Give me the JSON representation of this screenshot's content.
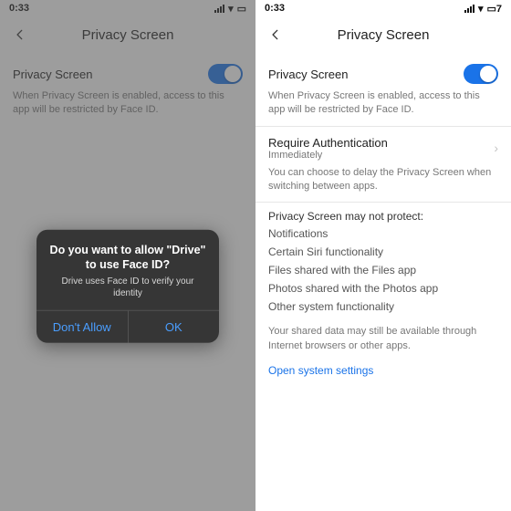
{
  "status": {
    "time": "0:33",
    "battery_right": "7"
  },
  "header": {
    "title": "Privacy Screen"
  },
  "toggle_row": {
    "label": "Privacy Screen",
    "on": true
  },
  "desc1": "When Privacy Screen is enabled, access to this app will be restricted by Face ID.",
  "req": {
    "label": "Require Authentication",
    "value": "Immediately"
  },
  "desc2": "You can choose to delay the Privacy Screen when switching between apps.",
  "list": {
    "head": "Privacy Screen may not protect:",
    "items": [
      "Notifications",
      "Certain Siri functionality",
      "Files shared with the Files app",
      "Photos shared with the Photos app",
      "Other system functionality"
    ]
  },
  "note": "Your shared data may still be available through Internet browsers or other apps.",
  "link": "Open system settings",
  "alert": {
    "title": "Do you want to allow \"Drive\" to use Face ID?",
    "msg": "Drive uses Face ID to verify your identity",
    "dont": "Don't Allow",
    "ok": "OK"
  }
}
